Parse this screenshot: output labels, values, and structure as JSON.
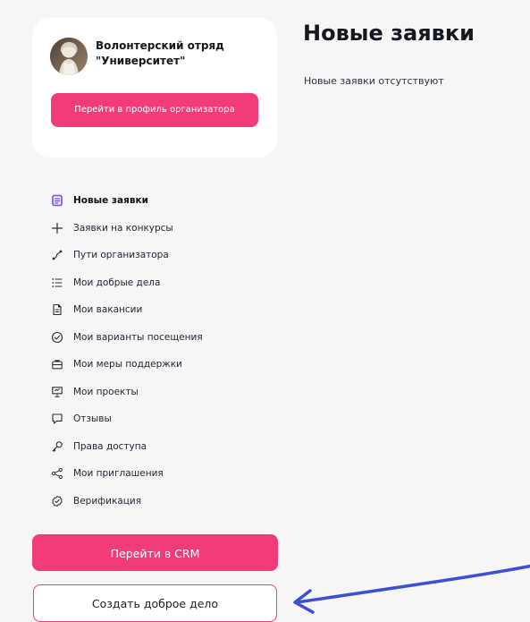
{
  "organizer": {
    "name": "Волонтерский отряд\n\"Университет\"",
    "profile_button": "Перейти в профиль организатора"
  },
  "sidebar": {
    "items": [
      {
        "label": "Новые заявки",
        "icon": "document-list-icon",
        "active": true
      },
      {
        "label": "Заявки на конкурсы",
        "icon": "plus-icon",
        "active": false
      },
      {
        "label": "Пути организатора",
        "icon": "route-icon",
        "active": false
      },
      {
        "label": "Мои добрые дела",
        "icon": "list-icon",
        "active": false
      },
      {
        "label": "Мои вакансии",
        "icon": "document-icon",
        "active": false
      },
      {
        "label": "Мои варианты посещения",
        "icon": "check-circle-icon",
        "active": false
      },
      {
        "label": "Мои меры поддержки",
        "icon": "briefcase-icon",
        "active": false
      },
      {
        "label": "Мои проекты",
        "icon": "presentation-icon",
        "active": false
      },
      {
        "label": "Отзывы",
        "icon": "chat-icon",
        "active": false
      },
      {
        "label": "Права доступа",
        "icon": "key-icon",
        "active": false
      },
      {
        "label": "Мои приглашения",
        "icon": "share-icon",
        "active": false
      },
      {
        "label": "Верификация",
        "icon": "verified-icon",
        "active": false
      }
    ]
  },
  "actions": {
    "crm": "Перейти в CRM",
    "create_good_deed": "Создать доброе дело"
  },
  "content": {
    "title": "Новые заявки",
    "empty_message": "Новые заявки отсутствуют"
  },
  "colors": {
    "accent": "#f13b7b",
    "active_icon": "#5d55ff",
    "arrow": "#3c50d7"
  }
}
